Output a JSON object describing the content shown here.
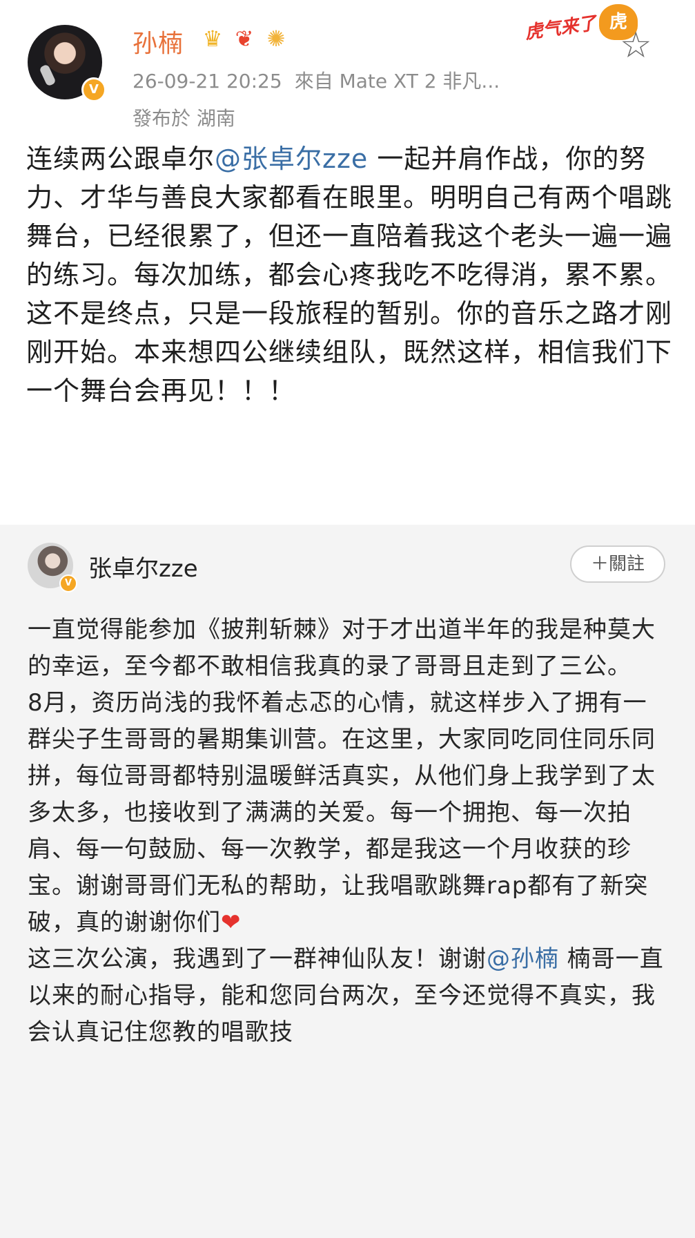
{
  "post": {
    "author": "孙楠",
    "timestamp": "26-09-21 20:25",
    "source": "來自 Mate XT 2 非凡...",
    "location": "發布於 湖南",
    "sticker_text": "虎气来了",
    "sticker_paw": "虎",
    "badges": {
      "crown": "♛",
      "bird": "❦",
      "fish": "✺"
    },
    "star": "☆",
    "text_before_mention": "连续两公跟卓尔",
    "mention": "@张卓尔zze",
    "text_after_mention": " 一起并肩作战，你的努力、才华与善良大家都看在眼里。明明自己有两个唱跳舞台，已经很累了，但还一直陪着我这个老头一遍一遍的练习。每次加练，都会心疼我吃不吃得消，累不累。这不是终点，只是一段旅程的暂别。你的音乐之路才刚刚开始。本来想四公继续组队，既然这样，相信我们下一个舞台会再见！！！"
  },
  "repost": {
    "author": "张卓尔zze",
    "follow_label": "＋關註",
    "paragraph1": "一直觉得能参加《披荆斩棘》对于才出道半年的我是种莫大的幸运，至今都不敢相信我真的录了哥哥且走到了三公。",
    "paragraph2": "8月，资历尚浅的我怀着忐忑的心情，就这样步入了拥有一群尖子生哥哥的暑期集训营。在这里，大家同吃同住同乐同拼，每位哥哥都特别温暖鲜活真实，从他们身上我学到了太多太多，也接收到了满满的关爱。每一个拥抱、每一次拍肩、每一句鼓励、每一次教学，都是我这一个月收获的珍宝。谢谢哥哥们无私的帮助，让我唱歌跳舞rap都有了新突破，真的谢谢你们",
    "heart": "❤",
    "paragraph3_before": "这三次公演，我遇到了一群神仙队友！谢谢",
    "paragraph3_mention": "@孙楠",
    "paragraph3_after": " 楠哥一直以来的耐心指导，能和您同台两次，至今还觉得不真实，我会认真记住您教的唱歌技"
  },
  "colors": {
    "name": "#e8713a",
    "mention": "#3a6ea5",
    "meta": "#8c8c8c",
    "verified": "#f5a623"
  }
}
